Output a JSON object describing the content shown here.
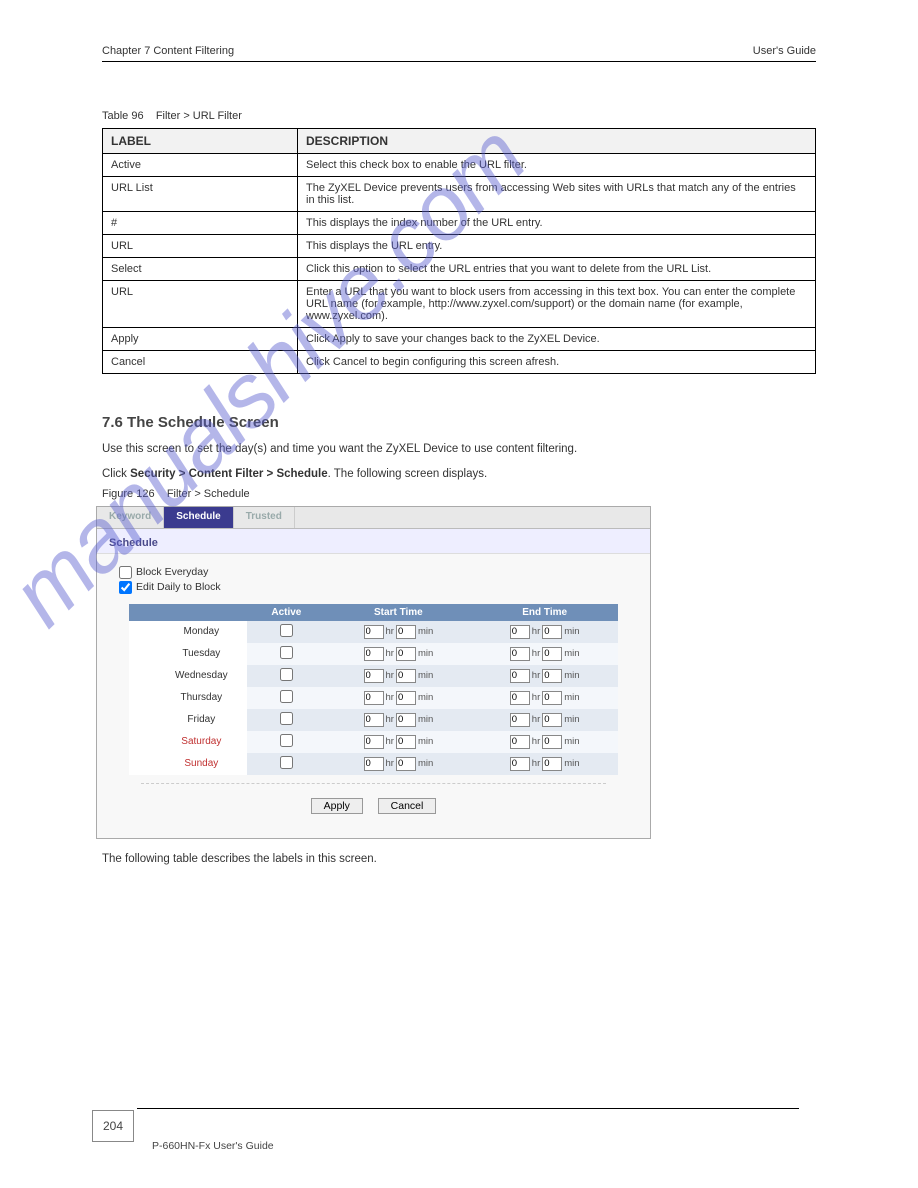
{
  "header": {
    "chapter": "Chapter 7 Content Filtering",
    "section": "User's Guide"
  },
  "watermark": "manualshive.com",
  "table96": {
    "caption": "Table 96    Filter > URL Filter",
    "headers": [
      "LABEL",
      "DESCRIPTION"
    ],
    "rows": [
      [
        "Active",
        "Select this check box to enable the URL filter."
      ],
      [
        "URL List",
        "The ZyXEL Device prevents users from accessing Web sites with URLs that match any of the entries in this list."
      ],
      [
        "#",
        "This displays the index number of the URL entry."
      ],
      [
        "URL",
        "This displays the URL entry."
      ],
      [
        "Select",
        "Click this option to select the URL entries that you want to delete from the URL List."
      ],
      [
        "URL",
        "Enter a URL that you want to block users from accessing in this text box. You can enter the complete URL name (for example, http://www.zyxel.com/support) or the domain name (for example, www.zyxel.com)."
      ],
      [
        "Apply",
        "Click Apply to save your changes back to the ZyXEL Device."
      ],
      [
        "Cancel",
        "Click Cancel to begin configuring this screen afresh."
      ]
    ]
  },
  "section": {
    "num": "7.6",
    "title": "  The Schedule Screen",
    "desc": "Use this screen to set the day(s) and time you want the ZyXEL Device to use content filtering.",
    "path_prefix": "Click ",
    "path_main": "Security > Content Filter > Schedule",
    "path_suffix": ". The following screen displays."
  },
  "figure": {
    "caption": "Figure 126    Filter > Schedule"
  },
  "ui": {
    "tabs": [
      "Keyword",
      "Schedule",
      "Trusted"
    ],
    "active_tab": "Schedule",
    "panel_title": "Schedule",
    "block_everyday": {
      "label": "Block Everyday",
      "checked": false
    },
    "edit_daily": {
      "label": "Edit Daily to Block",
      "checked": true
    },
    "sched_headers": [
      "",
      "Active",
      "Start Time",
      "End Time"
    ],
    "hr_label": "hr",
    "min_label": "min",
    "days": [
      {
        "name": "Monday",
        "weekend": false,
        "active": false,
        "start_hr": "0",
        "start_min": "0",
        "end_hr": "0",
        "end_min": "0"
      },
      {
        "name": "Tuesday",
        "weekend": false,
        "active": false,
        "start_hr": "0",
        "start_min": "0",
        "end_hr": "0",
        "end_min": "0"
      },
      {
        "name": "Wednesday",
        "weekend": false,
        "active": false,
        "start_hr": "0",
        "start_min": "0",
        "end_hr": "0",
        "end_min": "0"
      },
      {
        "name": "Thursday",
        "weekend": false,
        "active": false,
        "start_hr": "0",
        "start_min": "0",
        "end_hr": "0",
        "end_min": "0"
      },
      {
        "name": "Friday",
        "weekend": false,
        "active": false,
        "start_hr": "0",
        "start_min": "0",
        "end_hr": "0",
        "end_min": "0"
      },
      {
        "name": "Saturday",
        "weekend": true,
        "active": false,
        "start_hr": "0",
        "start_min": "0",
        "end_hr": "0",
        "end_min": "0"
      },
      {
        "name": "Sunday",
        "weekend": true,
        "active": false,
        "start_hr": "0",
        "start_min": "0",
        "end_hr": "0",
        "end_min": "0"
      }
    ],
    "apply": "Apply",
    "cancel": "Cancel"
  },
  "post_text": "The following table describes the labels in this screen.",
  "footer": {
    "page_num": "204",
    "guide": "P-660HN-Fx User's Guide"
  }
}
